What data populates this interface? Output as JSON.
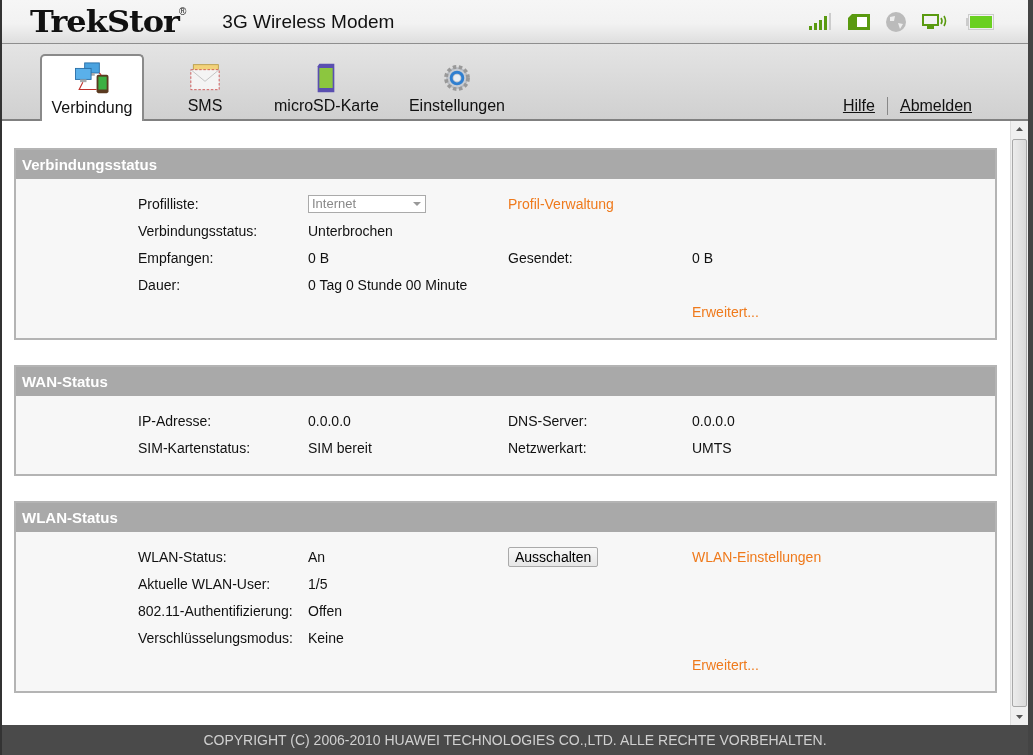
{
  "header": {
    "brand": "TrekStor",
    "registered": "®",
    "title": "3G Wireless Modem"
  },
  "tabs": [
    {
      "label": "Verbindung",
      "selected": true
    },
    {
      "label": "SMS",
      "selected": false
    },
    {
      "label": "microSD-Karte",
      "selected": false
    },
    {
      "label": "Einstellungen",
      "selected": false
    }
  ],
  "top_links": [
    "Hilfe",
    "Abmelden"
  ],
  "sections": [
    {
      "title": "Verbindungsstatus",
      "rows": [
        {
          "label": "Profilliste:",
          "value": {
            "kind": "select",
            "text": "Internet",
            "disabled": true
          },
          "side": [
            {
              "kind": "link",
              "text": "Profil-Verwaltung"
            }
          ]
        },
        {
          "label": "Verbindungsstatus:",
          "value": {
            "kind": "text",
            "text": "Unterbrochen"
          }
        },
        {
          "label": "Empfangen:",
          "value": {
            "kind": "text",
            "text": "0 B"
          },
          "side": [
            {
              "kind": "label",
              "text": "Gesendet:"
            },
            {
              "kind": "text",
              "text": "0 B"
            }
          ]
        },
        {
          "label": "Dauer:",
          "value": {
            "kind": "text",
            "text": "0 Tag 0 Stunde 00 Minute"
          }
        }
      ],
      "more_link": "Erweitert..."
    },
    {
      "title": "WAN-Status",
      "rows": [
        {
          "label": "IP-Adresse:",
          "value": {
            "kind": "text",
            "text": "0.0.0.0"
          },
          "side": [
            {
              "kind": "label",
              "text": "DNS-Server:"
            },
            {
              "kind": "text",
              "text": "0.0.0.0"
            }
          ]
        },
        {
          "label": "SIM-Kartenstatus:",
          "value": {
            "kind": "text",
            "text": "SIM bereit"
          },
          "side": [
            {
              "kind": "label",
              "text": "Netzwerkart:"
            },
            {
              "kind": "text",
              "text": "UMTS"
            }
          ]
        }
      ]
    },
    {
      "title": "WLAN-Status",
      "rows": [
        {
          "label": "WLAN-Status:",
          "value": {
            "kind": "text",
            "text": "An"
          },
          "side": [
            {
              "kind": "button",
              "text": "Ausschalten"
            },
            {
              "kind": "link",
              "text": "WLAN-Einstellungen"
            }
          ]
        },
        {
          "label": "Aktuelle WLAN-User:",
          "value": {
            "kind": "text",
            "text": "1/5"
          }
        },
        {
          "label": "802.11-Authentifizierung:",
          "value": {
            "kind": "text",
            "text": "Offen"
          }
        },
        {
          "label": "Verschlüsselungsmodus:",
          "value": {
            "kind": "text",
            "text": "Keine"
          }
        }
      ],
      "more_link": "Erweitert..."
    }
  ],
  "footer": "COPYRIGHT (C) 2006-2010 HUAWEI TECHNOLOGIES CO.,LTD. ALLE RECHTE VORBEHALTEN."
}
